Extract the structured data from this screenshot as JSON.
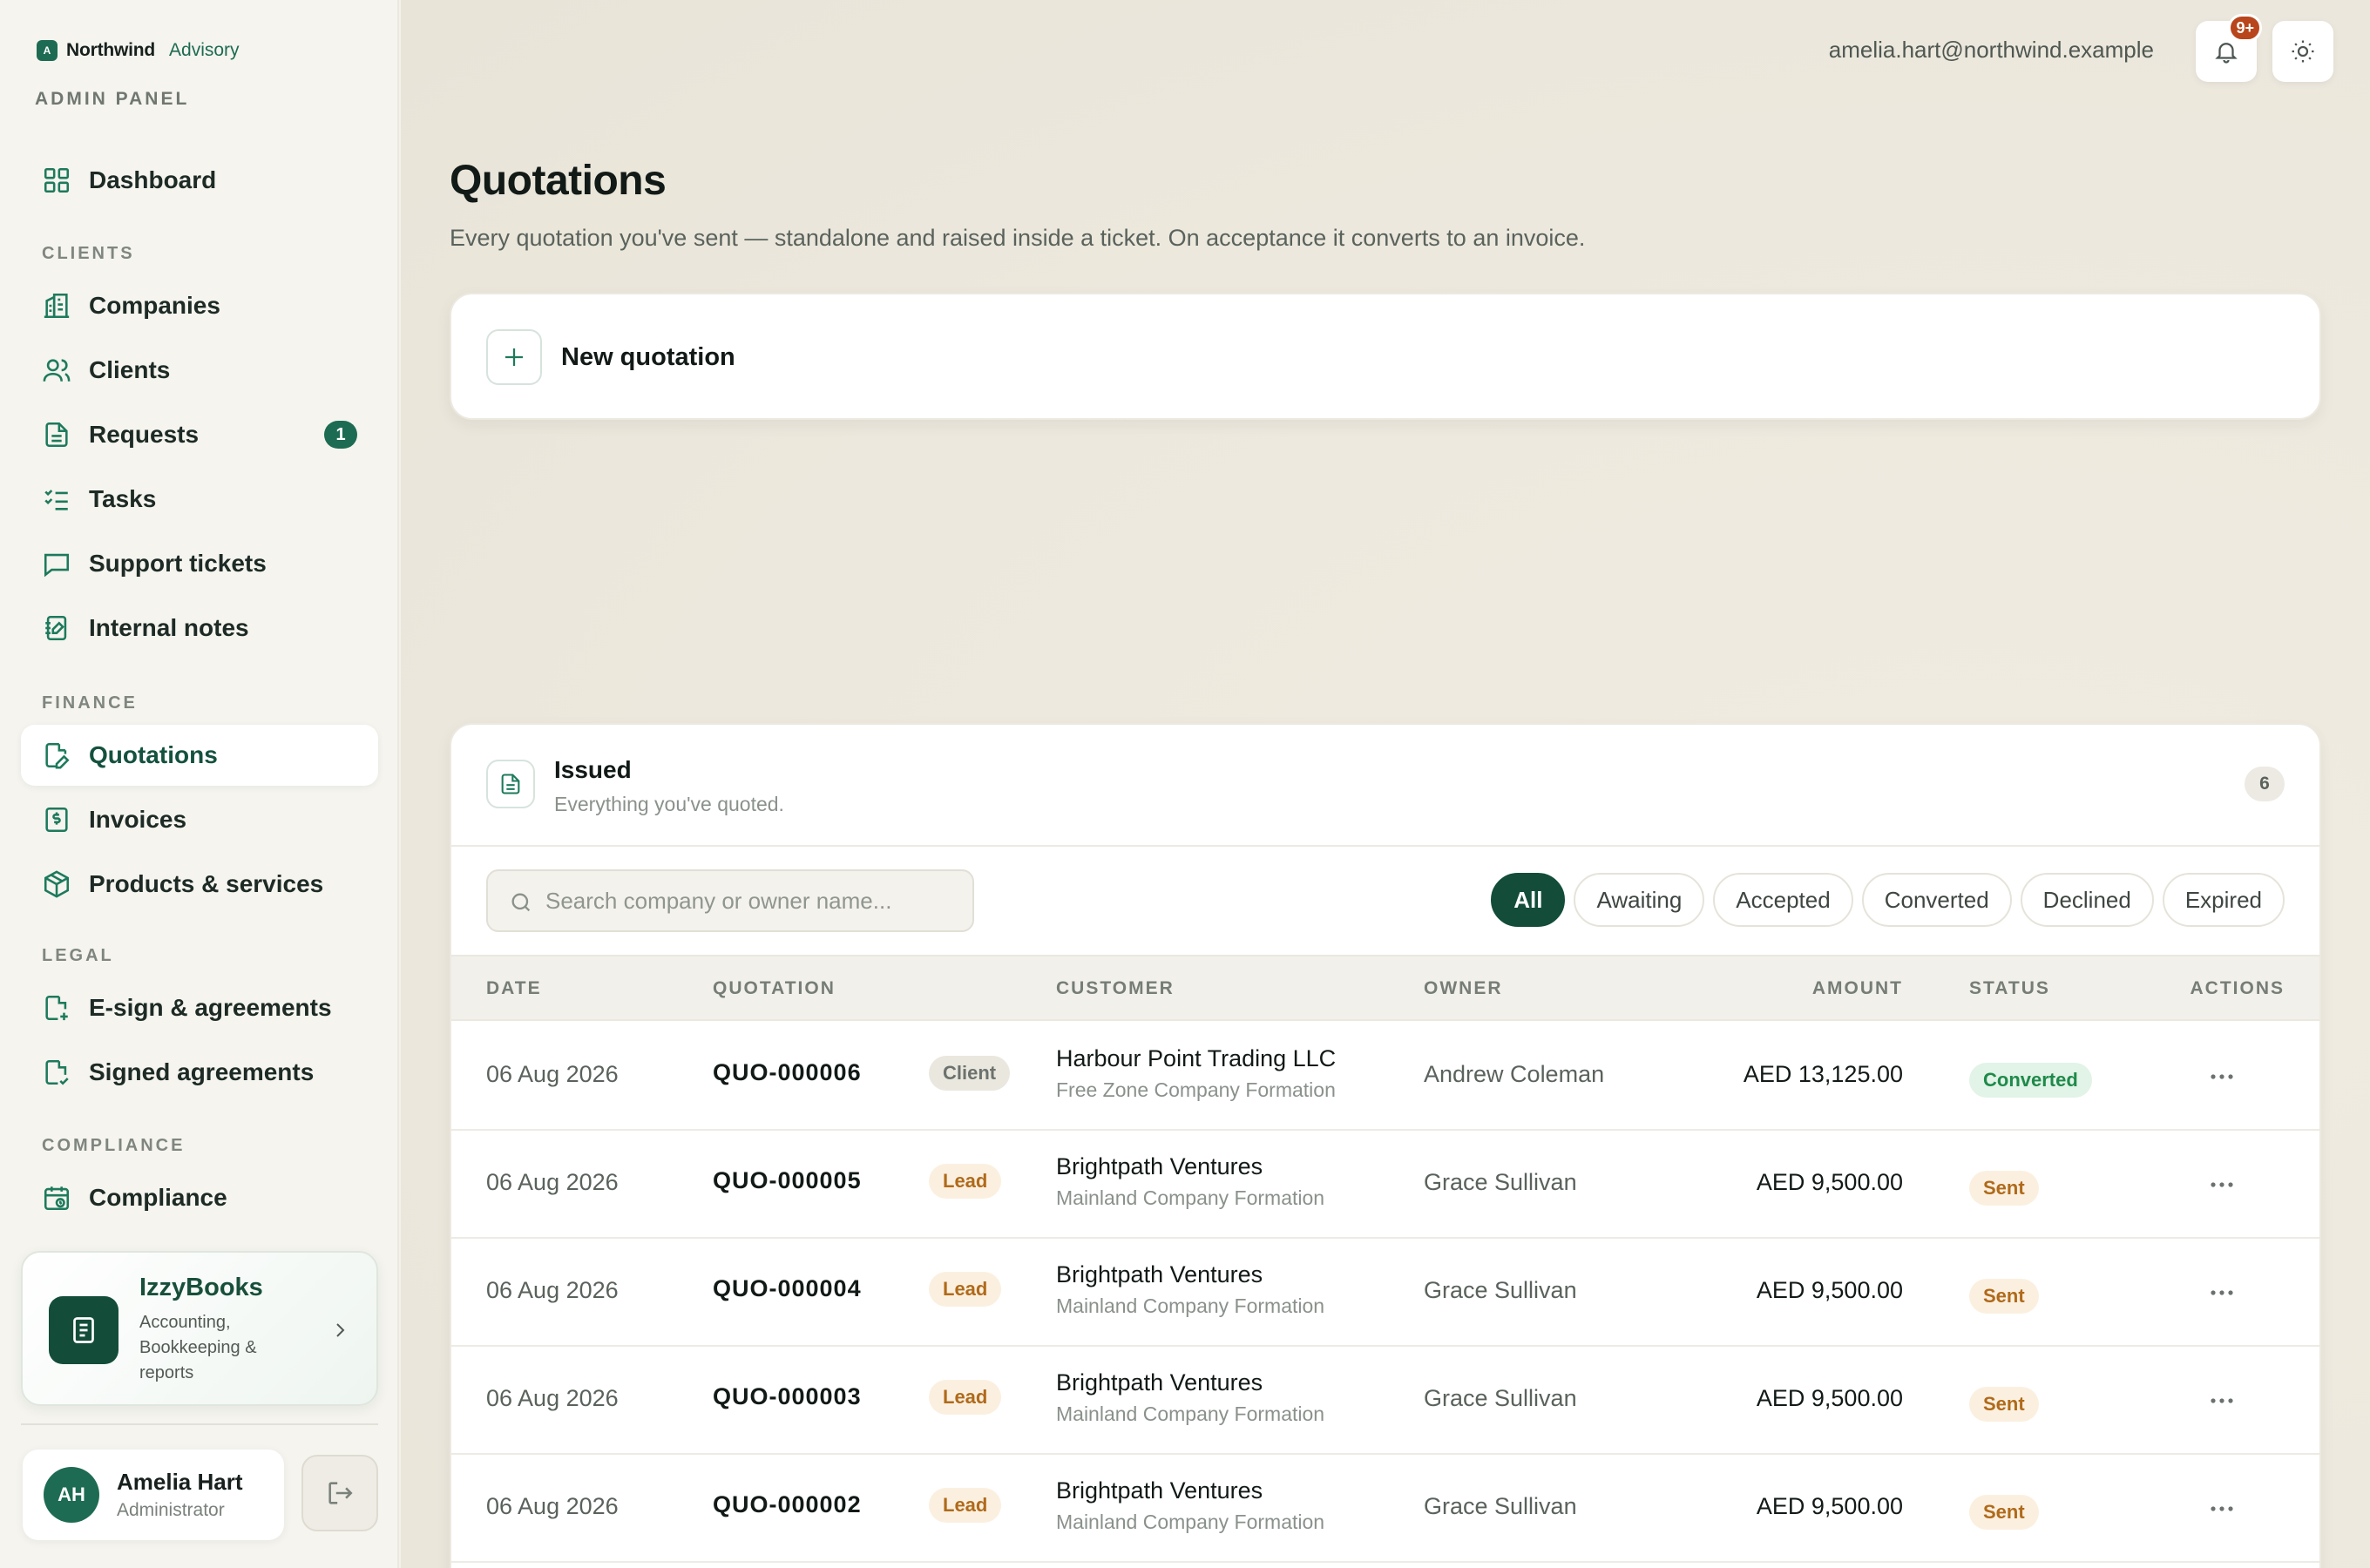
{
  "brand": {
    "mark": "A",
    "name": "Northwind",
    "sub": "Advisory",
    "panel": "ADMIN PANEL"
  },
  "sidebar": {
    "dashboard": "Dashboard",
    "sections": {
      "clients": "CLIENTS",
      "finance": "FINANCE",
      "legal": "LEGAL",
      "compliance": "COMPLIANCE"
    },
    "items": {
      "companies": "Companies",
      "clients": "Clients",
      "requests": "Requests",
      "requests_badge": "1",
      "tasks": "Tasks",
      "support": "Support tickets",
      "notes": "Internal notes",
      "quotations": "Quotations",
      "invoices": "Invoices",
      "products": "Products & services",
      "esign": "E-sign & agreements",
      "signed": "Signed agreements",
      "compliance": "Compliance"
    },
    "promo": {
      "title": "IzzyBooks",
      "subtitle": "Accounting, Bookkeeping & reports"
    },
    "user": {
      "initials": "AH",
      "name": "Amelia Hart",
      "role": "Administrator"
    }
  },
  "topbar": {
    "email": "amelia.hart@northwind.example",
    "notifications": "9+"
  },
  "page": {
    "title": "Quotations",
    "description": "Every quotation you've sent — standalone and raised inside a ticket. On acceptance it converts to an invoice.",
    "new_label": "New quotation"
  },
  "issued": {
    "title": "Issued",
    "subtitle": "Everything you've quoted.",
    "count": "6",
    "search_placeholder": "Search company or owner name...",
    "filters": [
      "All",
      "Awaiting",
      "Accepted",
      "Converted",
      "Declined",
      "Expired"
    ],
    "active_filter": "All",
    "columns": {
      "date": "DATE",
      "quotation": "QUOTATION",
      "customer": "CUSTOMER",
      "owner": "OWNER",
      "amount": "AMOUNT",
      "status": "STATUS",
      "actions": "ACTIONS"
    },
    "rows": [
      {
        "date": "06 Aug 2026",
        "id": "QUO-000006",
        "tag": "Client",
        "tag_type": "client",
        "customer": "Harbour Point Trading LLC",
        "service": "Free Zone Company Formation",
        "owner": "Andrew Coleman",
        "amount": "AED 13,125.00",
        "status": "Converted",
        "status_type": "converted"
      },
      {
        "date": "06 Aug 2026",
        "id": "QUO-000005",
        "tag": "Lead",
        "tag_type": "lead",
        "customer": "Brightpath Ventures",
        "service": "Mainland Company Formation",
        "owner": "Grace Sullivan",
        "amount": "AED 9,500.00",
        "status": "Sent",
        "status_type": "sent"
      },
      {
        "date": "06 Aug 2026",
        "id": "QUO-000004",
        "tag": "Lead",
        "tag_type": "lead",
        "customer": "Brightpath Ventures",
        "service": "Mainland Company Formation",
        "owner": "Grace Sullivan",
        "amount": "AED 9,500.00",
        "status": "Sent",
        "status_type": "sent"
      },
      {
        "date": "06 Aug 2026",
        "id": "QUO-000003",
        "tag": "Lead",
        "tag_type": "lead",
        "customer": "Brightpath Ventures",
        "service": "Mainland Company Formation",
        "owner": "Grace Sullivan",
        "amount": "AED 9,500.00",
        "status": "Sent",
        "status_type": "sent"
      },
      {
        "date": "06 Aug 2026",
        "id": "QUO-000002",
        "tag": "Lead",
        "tag_type": "lead",
        "customer": "Brightpath Ventures",
        "service": "Mainland Company Formation",
        "owner": "Grace Sullivan",
        "amount": "AED 9,500.00",
        "status": "Sent",
        "status_type": "sent"
      }
    ]
  },
  "colors": {
    "accent": "#1d6b52",
    "accent_dark": "#134d3a",
    "badge": "#b8451b"
  }
}
